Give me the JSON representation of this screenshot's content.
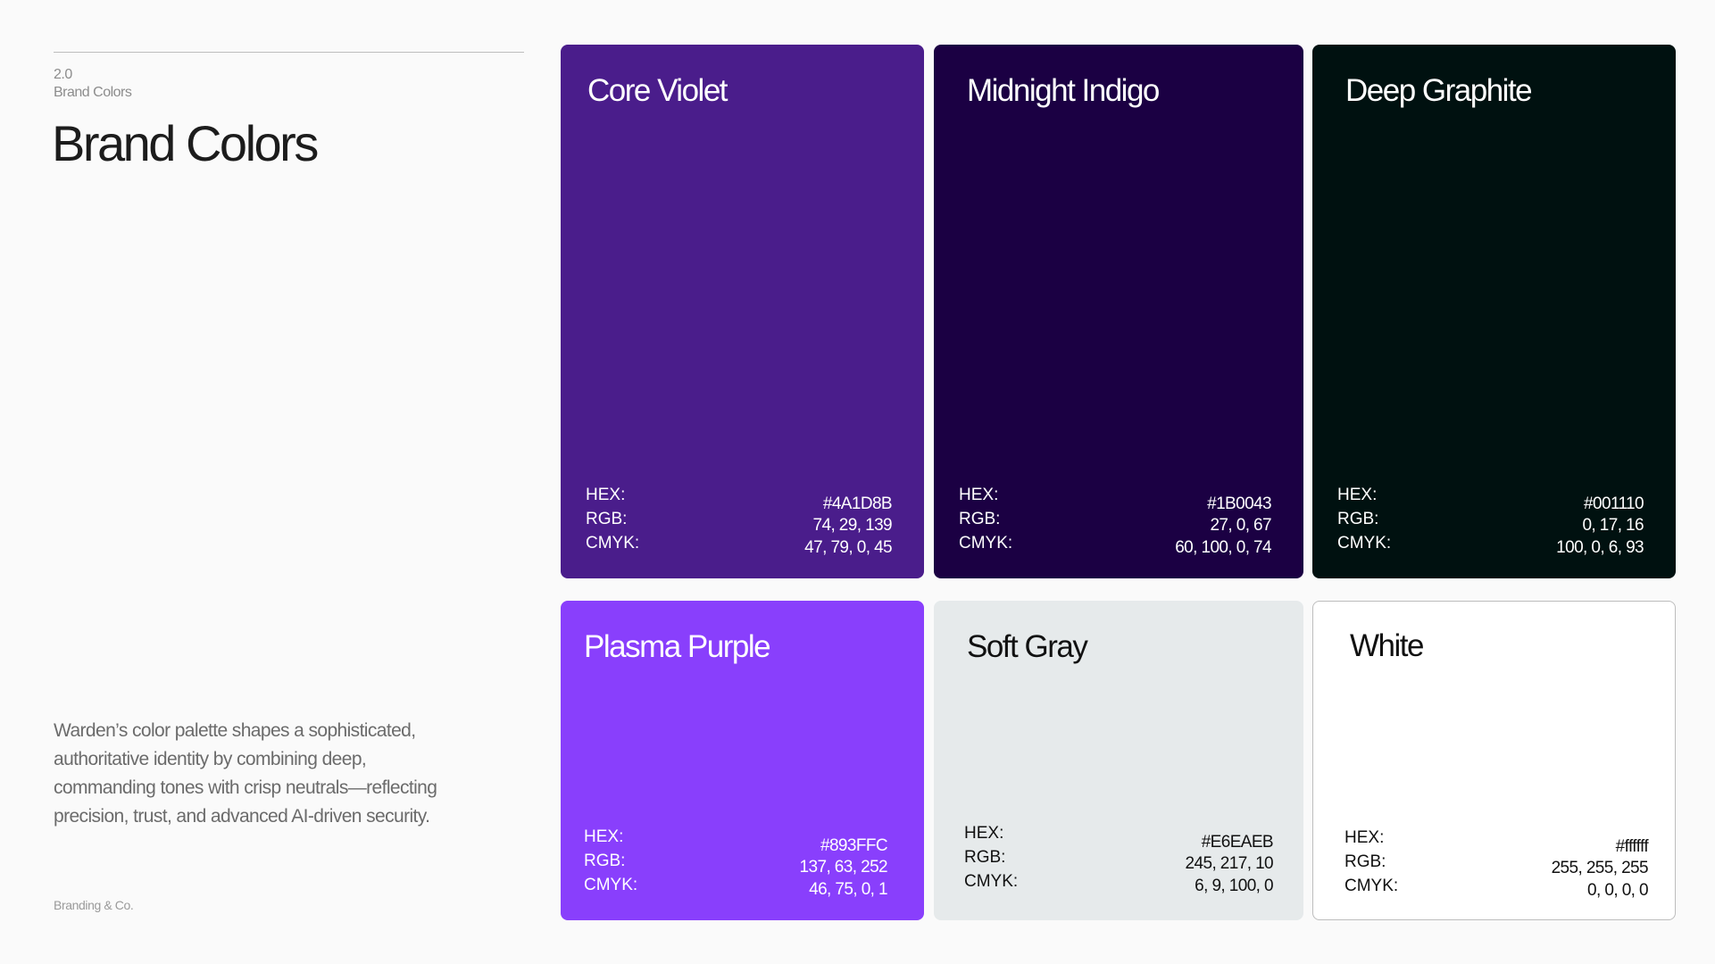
{
  "section": {
    "number": "2.0",
    "name": "Brand Colors"
  },
  "title": "Brand Colors",
  "description": "Warden’s color palette shapes a sophisticated, authoritative identity by combining deep, commanding tones with crisp neutrals—reflecting precision, trust, and advanced AI-driven security.",
  "footer": "Branding & Co.",
  "labels": {
    "hex": "HEX:",
    "rgb": "RGB:",
    "cmyk": "CMYK:"
  },
  "colors": [
    {
      "name": "Core Violet",
      "hex": "#4A1D8B",
      "rgb": "74, 29, 139",
      "cmyk": "47, 79, 0, 45",
      "swatch": "#4A1D8B",
      "text_color": "#ffffff"
    },
    {
      "name": "Midnight Indigo",
      "hex": "#1B0043",
      "rgb": "27, 0, 67",
      "cmyk": "60, 100, 0, 74",
      "swatch": "#1B0043",
      "text_color": "#ffffff"
    },
    {
      "name": "Deep Graphite",
      "hex": "#001110",
      "rgb": "0, 17, 16",
      "cmyk": "100, 0, 6, 93",
      "swatch": "#001110",
      "text_color": "#ffffff"
    },
    {
      "name": "Plasma Purple",
      "hex": "#893FFC",
      "rgb": "137, 63, 252",
      "cmyk": "46, 75, 0, 1",
      "swatch": "#893FFC",
      "text_color": "#ffffff"
    },
    {
      "name": "Soft Gray",
      "hex": "#E6EAEB",
      "rgb": "245, 217, 10",
      "cmyk": "6, 9, 100, 0",
      "swatch": "#E6EAEB",
      "text_color": "#111111"
    },
    {
      "name": "White",
      "hex": "#ffffff",
      "rgb": "255, 255, 255",
      "cmyk": "0, 0, 0, 0",
      "swatch": "#ffffff",
      "text_color": "#111111"
    }
  ]
}
